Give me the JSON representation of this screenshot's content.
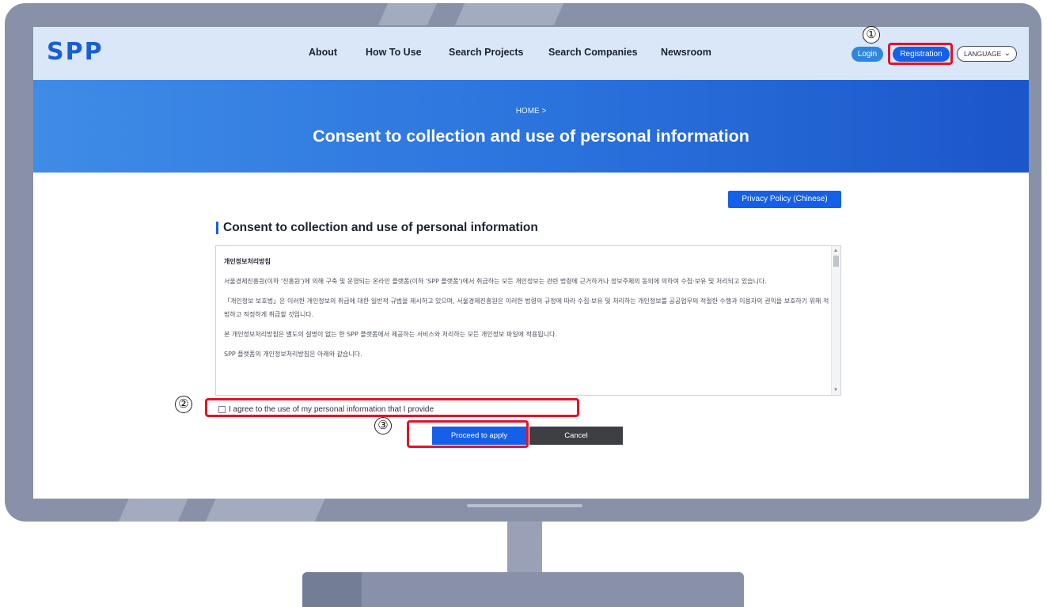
{
  "header": {
    "logo": "SPP",
    "nav": [
      {
        "label": "About"
      },
      {
        "label": "How To Use"
      },
      {
        "label": "Search Projects"
      },
      {
        "label": "Search Companies"
      },
      {
        "label": "Newsroom"
      }
    ],
    "login_label": "Login",
    "registration_label": "Registration",
    "language_label": "LANGUAGE"
  },
  "banner": {
    "breadcrumb": "HOME >",
    "title": "Consent to collection and use of personal information"
  },
  "content": {
    "privacy_button": "Privacy Policy (Chinese)",
    "section_title": "Consent to collection and use of personal information",
    "policy": {
      "heading": "개인정보처리방침",
      "paragraphs": [
        "서울경제진흥원(이하 '진흥원')에 의해 구축 및 운영되는 온라인 플랫폼(이하 'SPP 플랫폼')에서 취급하는 모든 개인정보는 관련 법령에 근거하거나 정보주체의 동의에 의하여 수집·보유 및 처리되고 있습니다.",
        "「개인정보 보호법」은 이러한 개인정보의 취급에 대한 일반적 규범을 제시하고 있으며, 서울경제진흥원은 이러한 법령의 규정에 따라 수집·보유 및 처리하는 개인정보를 공공업무의 적절한 수행과 이용자의 권익을 보호하기 위해 적법하고 적정하게 취급할 것입니다.",
        "본 개인정보처리방침은 별도의 설명이 없는 한 SPP 플랫폼에서 제공하는 서비스와 처리하는 모든 개인정보 파일에 적용됩니다.",
        "SPP 플랫폼의 개인정보처리방침은 아래와 같습니다."
      ]
    },
    "agree_label": "I agree to the use of my personal information that I provide",
    "agree_checked": false,
    "apply_label": "Proceed to apply",
    "cancel_label": "Cancel"
  },
  "annotations": {
    "step1": "①",
    "step2": "②",
    "step3": "③",
    "highlight_color": "#e0142a"
  },
  "colors": {
    "brand": "#1a5fd1",
    "primary_button": "#1560e8",
    "cancel_button": "#3d3f45",
    "header_bg": "#d9e7f8",
    "monitor": "#8891a8"
  }
}
